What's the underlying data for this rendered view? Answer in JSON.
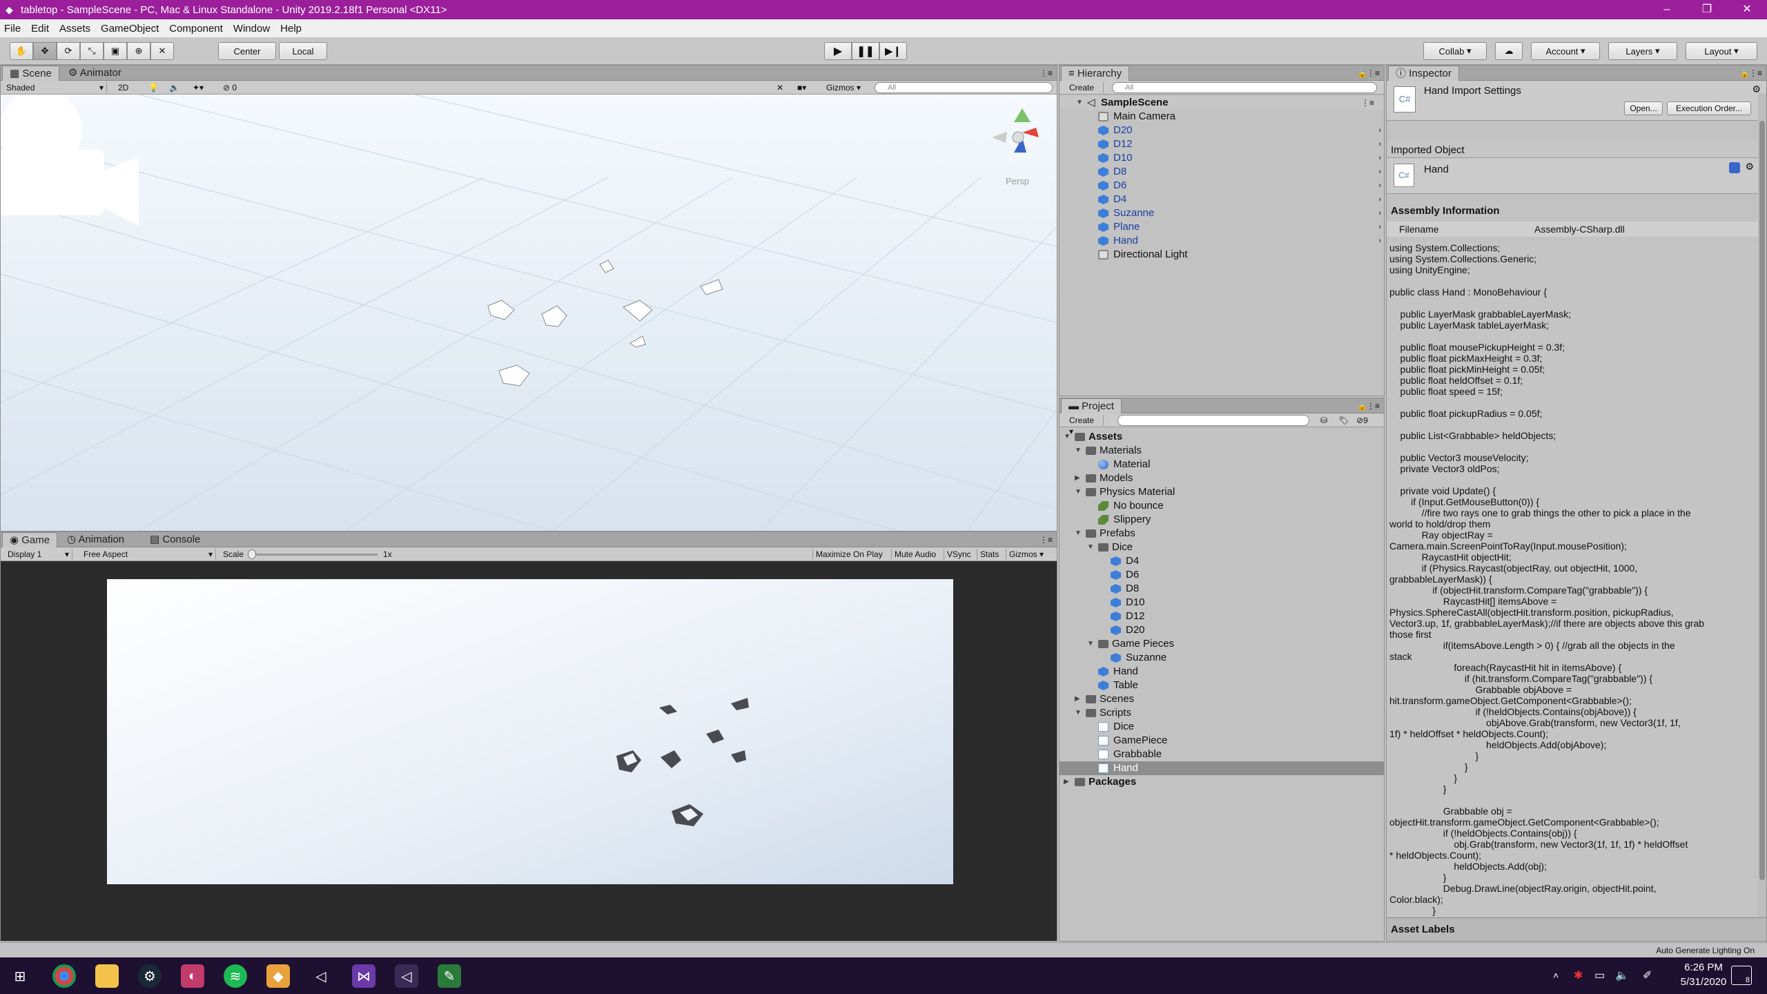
{
  "window": {
    "title": "tabletop - SampleScene - PC, Mac & Linux Standalone - Unity 2019.2.18f1 Personal <DX11>",
    "controls": [
      "–",
      "❐",
      "✕"
    ]
  },
  "menu": [
    "File",
    "Edit",
    "Assets",
    "GameObject",
    "Component",
    "Window",
    "Help"
  ],
  "toolbar": {
    "pivot": "Center",
    "space": "Local",
    "collab": "Collab",
    "account": "Account",
    "layers": "Layers",
    "layout": "Layout"
  },
  "scene_panel": {
    "tabs": [
      "Scene",
      "Animator"
    ],
    "shading": "Shaded",
    "mode_2d": "2D",
    "hidden_count": "0",
    "gizmos": "Gizmos",
    "search_placeholder": "All",
    "persp_label": "Persp"
  },
  "game_panel": {
    "tabs": [
      "Game",
      "Animation",
      "Console"
    ],
    "display": "Display 1",
    "aspect": "Free Aspect",
    "scale_label": "Scale",
    "scale_value": "1x",
    "toggles": [
      "Maximize On Play",
      "Mute Audio",
      "VSync",
      "Stats",
      "Gizmos"
    ]
  },
  "hierarchy": {
    "title": "Hierarchy",
    "create": "Create",
    "search_placeholder": "All",
    "scene": "SampleScene",
    "items": [
      {
        "label": "Main Camera",
        "prefab": false
      },
      {
        "label": "D20",
        "prefab": true
      },
      {
        "label": "D12",
        "prefab": true
      },
      {
        "label": "D10",
        "prefab": true
      },
      {
        "label": "D8",
        "prefab": true
      },
      {
        "label": "D6",
        "prefab": true
      },
      {
        "label": "D4",
        "prefab": true
      },
      {
        "label": "Suzanne",
        "prefab": true
      },
      {
        "label": "Plane",
        "prefab": true
      },
      {
        "label": "Hand",
        "prefab": true
      },
      {
        "label": "Directional Light",
        "prefab": false
      }
    ]
  },
  "project": {
    "title": "Project",
    "create": "Create",
    "filter_count": "9",
    "tree": {
      "assets": "Assets",
      "materials": "Materials",
      "material": "Material",
      "models": "Models",
      "physics_material": "Physics Material",
      "no_bounce": "No bounce",
      "slippery": "Slippery",
      "prefabs": "Prefabs",
      "dice": "Dice",
      "dice_items": [
        "D4",
        "D6",
        "D8",
        "D10",
        "D12",
        "D20"
      ],
      "game_pieces": "Game Pieces",
      "suzanne": "Suzanne",
      "hand": "Hand",
      "table": "Table",
      "scenes": "Scenes",
      "scripts": "Scripts",
      "script_items": [
        "Dice",
        "GamePiece",
        "Grabbable",
        "Hand"
      ],
      "packages": "Packages"
    }
  },
  "inspector": {
    "title": "Inspector",
    "header": "Hand Import Settings",
    "open": "Open...",
    "execution_order": "Execution Order...",
    "imported_object": "Imported Object",
    "object_name": "Hand",
    "assembly_info": "Assembly Information",
    "filename_label": "Filename",
    "filename_value": "Assembly-CSharp.dll",
    "asset_labels": "Asset Labels",
    "code": "using System.Collections;\nusing System.Collections.Generic;\nusing UnityEngine;\n\npublic class Hand : MonoBehaviour {\n\n    public LayerMask grabbableLayerMask;\n    public LayerMask tableLayerMask;\n\n    public float mousePickupHeight = 0.3f;\n    public float pickMaxHeight = 0.3f;\n    public float pickMinHeight = 0.05f;\n    public float heldOffset = 0.1f;\n    public float speed = 15f;\n\n    public float pickupRadius = 0.05f;\n\n    public List<Grabbable> heldObjects;\n\n    public Vector3 mouseVelocity;\n    private Vector3 oldPos;\n\n    private void Update() {\n        if (Input.GetMouseButton(0)) {\n            //fire two rays one to grab things the other to pick a place in the\nworld to hold/drop them\n            Ray objectRay =\nCamera.main.ScreenPointToRay(Input.mousePosition);\n            RaycastHit objectHit;\n            if (Physics.Raycast(objectRay, out objectHit, 1000,\ngrabbableLayerMask)) {\n                if (objectHit.transform.CompareTag(\"grabbable\")) {\n                    RaycastHit[] itemsAbove =\nPhysics.SphereCastAll(objectHit.transform.position, pickupRadius,\nVector3.up, 1f, grabbableLayerMask);//if there are objects above this grab\nthose first\n                    if(itemsAbove.Length > 0) { //grab all the objects in the\nstack\n                        foreach(RaycastHit hit in itemsAbove) {\n                            if (hit.transform.CompareTag(\"grabbable\")) {\n                                Grabbable objAbove =\nhit.transform.gameObject.GetComponent<Grabbable>();\n                                if (!heldObjects.Contains(objAbove)) {\n                                    objAbove.Grab(transform, new Vector3(1f, 1f,\n1f) * heldOffset * heldObjects.Count);\n                                    heldObjects.Add(objAbove);\n                                }\n                            }\n                        }\n                    }\n\n                    Grabbable obj =\nobjectHit.transform.gameObject.GetComponent<Grabbable>();\n                    if (!heldObjects.Contains(obj)) {\n                        obj.Grab(transform, new Vector3(1f, 1f, 1f) * heldOffset\n* heldObjects.Count);\n                        heldObjects.Add(obj);\n                    }\n                    Debug.DrawLine(objectRay.origin, objectHit.point,\nColor.black);\n                }\n            }"
  },
  "statusbar": {
    "right": "Auto Generate Lighting On"
  },
  "taskbar": {
    "time": "6:26 PM",
    "date": "5/31/2020",
    "notifications": "8"
  }
}
